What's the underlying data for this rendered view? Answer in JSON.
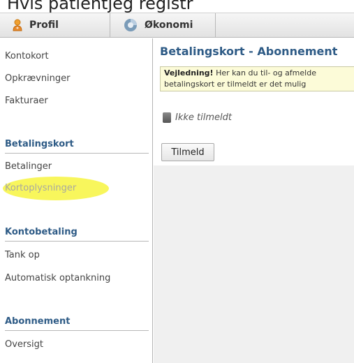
{
  "top_fragment": "Hvis patientjeg registr",
  "tabs": [
    {
      "label": "Profil",
      "icon": "user-icon"
    },
    {
      "label": "Økonomi",
      "icon": "economy-icon"
    }
  ],
  "sidebar": {
    "items_top": [
      "Kontokort",
      "Opkrævninger",
      "Fakturaer"
    ],
    "section_betalingskort": {
      "title": "Betalingskort",
      "items": [
        "Betalinger",
        "Kortoplysninger"
      ]
    },
    "section_kontobetaling": {
      "title": "Kontobetaling",
      "items": [
        "Tank op",
        "Automatisk optankning"
      ]
    },
    "section_abonnement": {
      "title": "Abonnement",
      "items": [
        "Oversigt"
      ]
    },
    "highlight_color": "#f7f540"
  },
  "main": {
    "title": "Betalingskort - Abonnement",
    "notice_bold": "Vejledning!",
    "notice_line1": " Her kan du til- og afmelde",
    "notice_line2": "betalingskort er tilmeldt er det mulig",
    "status_text": "Ikke tilmeldt",
    "button_label": "Tilmeld"
  },
  "colors": {
    "accent": "#2e5b86",
    "notice_bg": "#fcfbd8",
    "content_bg": "#f0f0f0"
  }
}
